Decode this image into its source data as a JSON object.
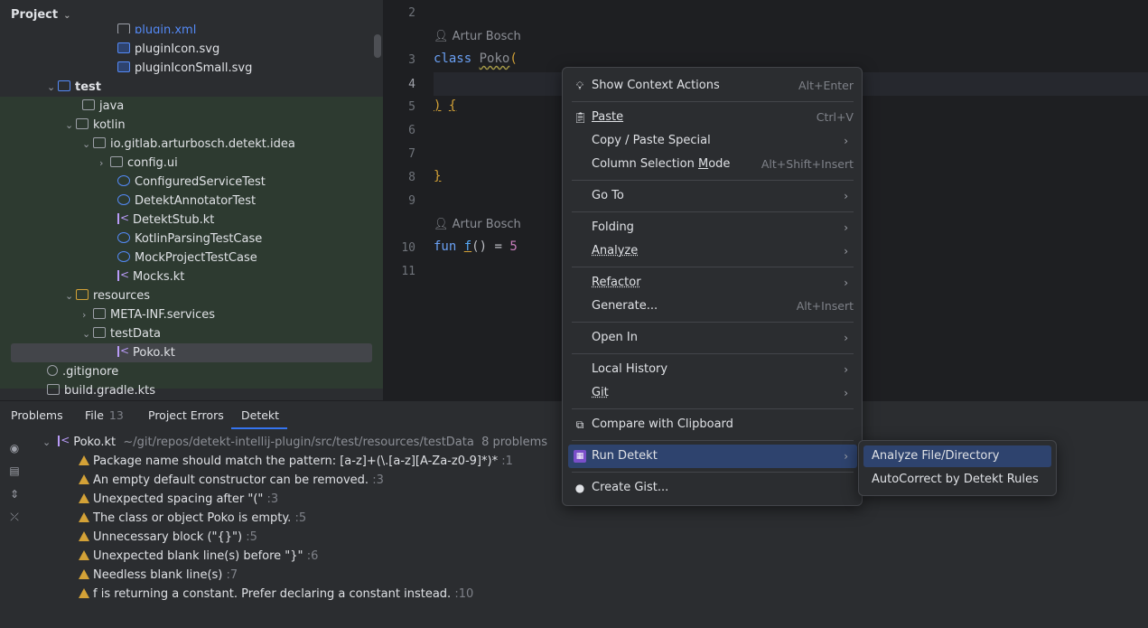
{
  "project_panel": {
    "title": "Project",
    "items": [
      {
        "label": "plugin.xml"
      },
      {
        "label": "pluginIcon.svg"
      },
      {
        "label": "pluginIconSmall.svg"
      },
      {
        "label": "test"
      },
      {
        "label": "java"
      },
      {
        "label": "kotlin"
      },
      {
        "label": "io.gitlab.arturbosch.detekt.idea"
      },
      {
        "label": "config.ui"
      },
      {
        "label": "ConfiguredServiceTest"
      },
      {
        "label": "DetektAnnotatorTest"
      },
      {
        "label": "DetektStub.kt"
      },
      {
        "label": "KotlinParsingTestCase"
      },
      {
        "label": "MockProjectTestCase"
      },
      {
        "label": "Mocks.kt"
      },
      {
        "label": "resources"
      },
      {
        "label": "META-INF.services"
      },
      {
        "label": "testData"
      },
      {
        "label": "Poko.kt"
      },
      {
        "label": ".gitignore"
      },
      {
        "label": "build.gradle.kts"
      }
    ]
  },
  "editor": {
    "lines": {
      "l2": "2",
      "l3": "3",
      "l4": "4",
      "l5": "5",
      "l6": "6",
      "l7": "7",
      "l8": "8",
      "l9": "9",
      "l10": "10",
      "l11": "11"
    },
    "author": "Artur Bosch",
    "code": {
      "class_kw": "class",
      "class_name": "Poko",
      "open_paren": "(",
      "close_paren": ")",
      "open_brace": "{",
      "close_brace": "}",
      "fun_kw": "fun",
      "fun_name": "f",
      "fun_rest": "() =",
      "fun_value": "5"
    }
  },
  "bottom_panel": {
    "tabs": {
      "problems": "Problems",
      "file": "File",
      "file_count": "13",
      "project_errors": "Project Errors",
      "detekt": "Detekt"
    },
    "file_header": {
      "name": "Poko.kt",
      "path": "~/git/repos/detekt-intellij-plugin/src/test/resources/testData",
      "count": "8 problems"
    },
    "problems": [
      {
        "text": "Package name should match the pattern: [a-z]+(\\.[a-z][A-Za-z0-9]*)*",
        "loc": ":1"
      },
      {
        "text": "An empty default constructor can be removed.",
        "loc": ":3"
      },
      {
        "text": "Unexpected spacing after \"(\"",
        "loc": ":3"
      },
      {
        "text": "The class or object Poko is empty.",
        "loc": ":5"
      },
      {
        "text": "Unnecessary block (\"{}\")",
        "loc": ":5"
      },
      {
        "text": "Unexpected blank line(s) before \"}\"",
        "loc": ":6"
      },
      {
        "text": "Needless blank line(s)",
        "loc": ":7"
      },
      {
        "text": "f is returning a constant. Prefer declaring a constant instead.",
        "loc": ":10"
      }
    ]
  },
  "context_menu": {
    "show_context_actions": {
      "label": "Show Context Actions",
      "shortcut": "Alt+Enter"
    },
    "paste": {
      "label": "Paste",
      "shortcut": "Ctrl+V"
    },
    "copy_paste_special": {
      "label": "Copy / Paste Special"
    },
    "column_selection": {
      "label_pre": "Column Selection ",
      "label_u": "M",
      "label_post": "ode",
      "shortcut": "Alt+Shift+Insert"
    },
    "go_to": {
      "label": "Go To"
    },
    "folding": {
      "label": "Folding"
    },
    "analyze": {
      "label": "Analyze"
    },
    "refactor": {
      "label": "Refactor"
    },
    "generate": {
      "label": "Generate...",
      "shortcut": "Alt+Insert"
    },
    "open_in": {
      "label": "Open In"
    },
    "local_history": {
      "label": "Local History"
    },
    "git": {
      "label": "Git"
    },
    "compare_clipboard": {
      "label": "Compare with Clipboard"
    },
    "run_detekt": {
      "label": "Run Detekt"
    },
    "create_gist": {
      "label": "Create Gist..."
    }
  },
  "submenu": {
    "analyze_file": "Analyze File/Directory",
    "autocorrect": "AutoCorrect by Detekt Rules"
  },
  "colors": {
    "accent": "#3574f0",
    "highlight": "#2e436e",
    "warning": "#d4a237",
    "test_folder_bg": "#2d3a30"
  }
}
